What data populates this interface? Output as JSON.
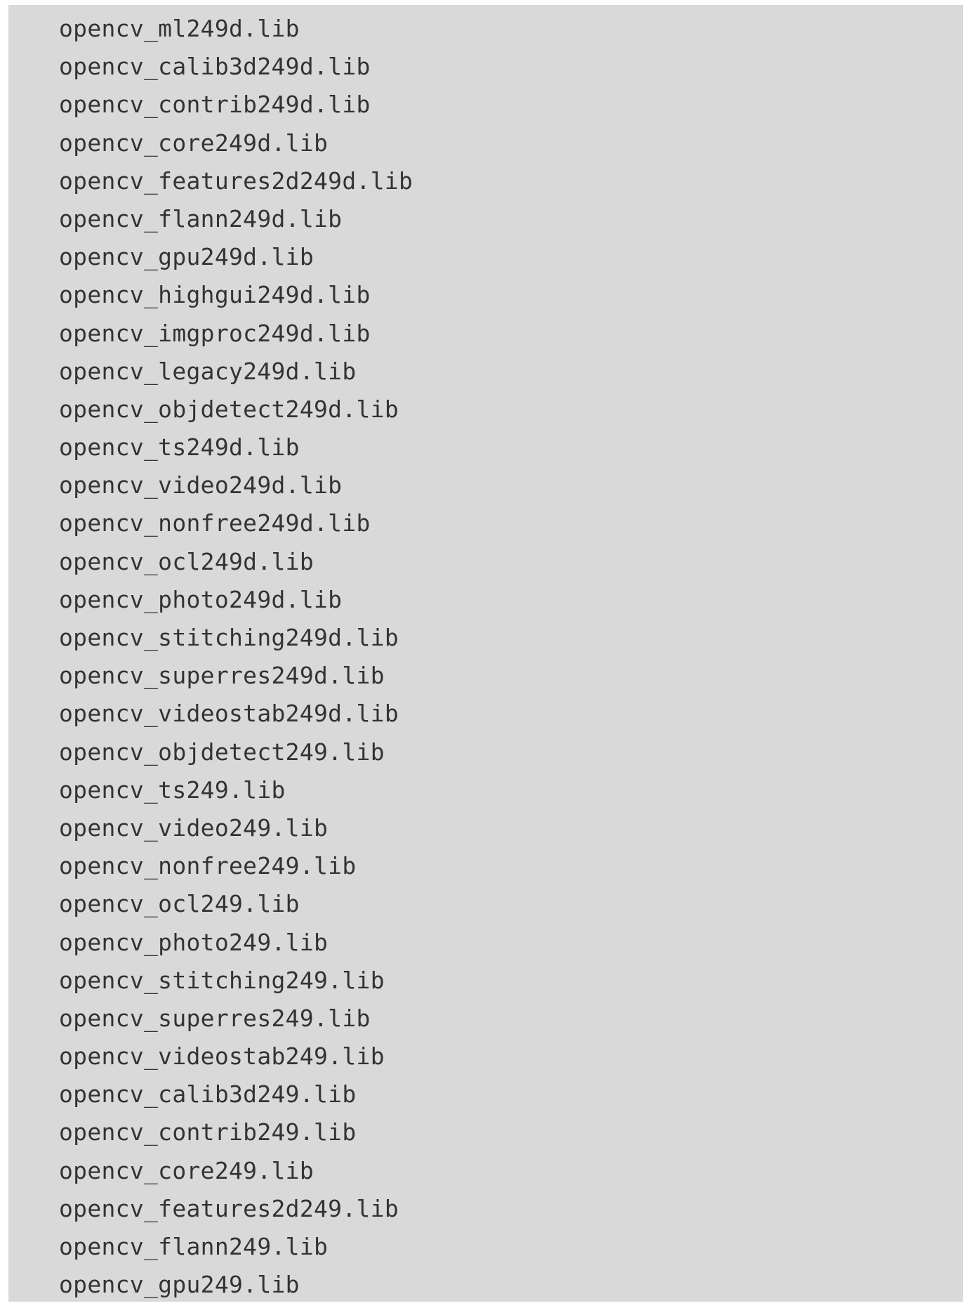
{
  "code_block": {
    "lines": [
      "opencv_ml249d.lib",
      "opencv_calib3d249d.lib",
      "opencv_contrib249d.lib",
      "opencv_core249d.lib",
      "opencv_features2d249d.lib",
      "opencv_flann249d.lib",
      "opencv_gpu249d.lib",
      "opencv_highgui249d.lib",
      "opencv_imgproc249d.lib",
      "opencv_legacy249d.lib",
      "opencv_objdetect249d.lib",
      "opencv_ts249d.lib",
      "opencv_video249d.lib",
      "opencv_nonfree249d.lib",
      "opencv_ocl249d.lib",
      "opencv_photo249d.lib",
      "opencv_stitching249d.lib",
      "opencv_superres249d.lib",
      "opencv_videostab249d.lib",
      "opencv_objdetect249.lib",
      "opencv_ts249.lib",
      "opencv_video249.lib",
      "opencv_nonfree249.lib",
      "opencv_ocl249.lib",
      "opencv_photo249.lib",
      "opencv_stitching249.lib",
      "opencv_superres249.lib",
      "opencv_videostab249.lib",
      "opencv_calib3d249.lib",
      "opencv_contrib249.lib",
      "opencv_core249.lib",
      "opencv_features2d249.lib",
      "opencv_flann249.lib",
      "opencv_gpu249.lib"
    ]
  }
}
